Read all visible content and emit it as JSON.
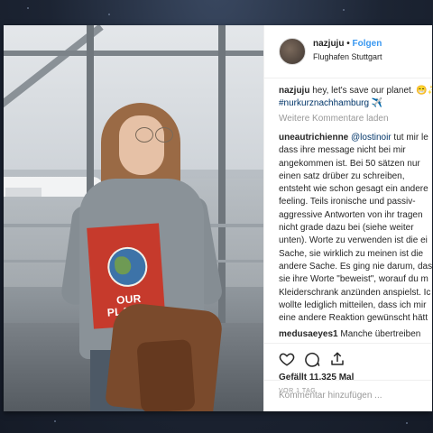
{
  "post": {
    "username": "nazjuju",
    "dot": "•",
    "follow_label": "Folgen",
    "location": "Flughafen Stuttgart",
    "caption_user": "nazjuju",
    "caption_text": "hey, let's save our planet. 😁✨",
    "caption_hashtag": "#nurkurznachhamburg ✈️",
    "more_comments": "Weitere Kommentare laden",
    "sweater_print": "OUR PLANET"
  },
  "comment1": {
    "user": "uneautrichienne",
    "mention": "@lostinoir",
    "lines": [
      "tut mir le",
      "dass ihre message nicht bei mir",
      "angekommen ist. Bei 50 sätzen nur",
      "einen satz drüber zu schreiben,",
      "entsteht wie schon gesagt ein andere",
      "feeling. Teils ironische und passiv-",
      "aggressive Antworten von ihr tragen",
      "nicht grade dazu bei (siehe weiter",
      "unten). Worte zu verwenden ist die ei",
      "Sache, sie wirklich zu meinen ist die",
      "andere Sache. Es ging nie darum, dass",
      "sie ihre Worte \"beweist\", worauf du m",
      "Kleiderschrank anzünden anspielst. Ic",
      "wollte lediglich mitteilen, dass ich mir",
      "eine andere Reaktion gewünscht hätt"
    ]
  },
  "comment2": {
    "user": "medusaeyes1",
    "text": "Manche übertreiben"
  },
  "actions": {
    "likes": "Gefällt 11.325 Mal",
    "ago": "VOR 1 TAG",
    "add_comment_placeholder": "Kommentar hinzufügen ..."
  }
}
